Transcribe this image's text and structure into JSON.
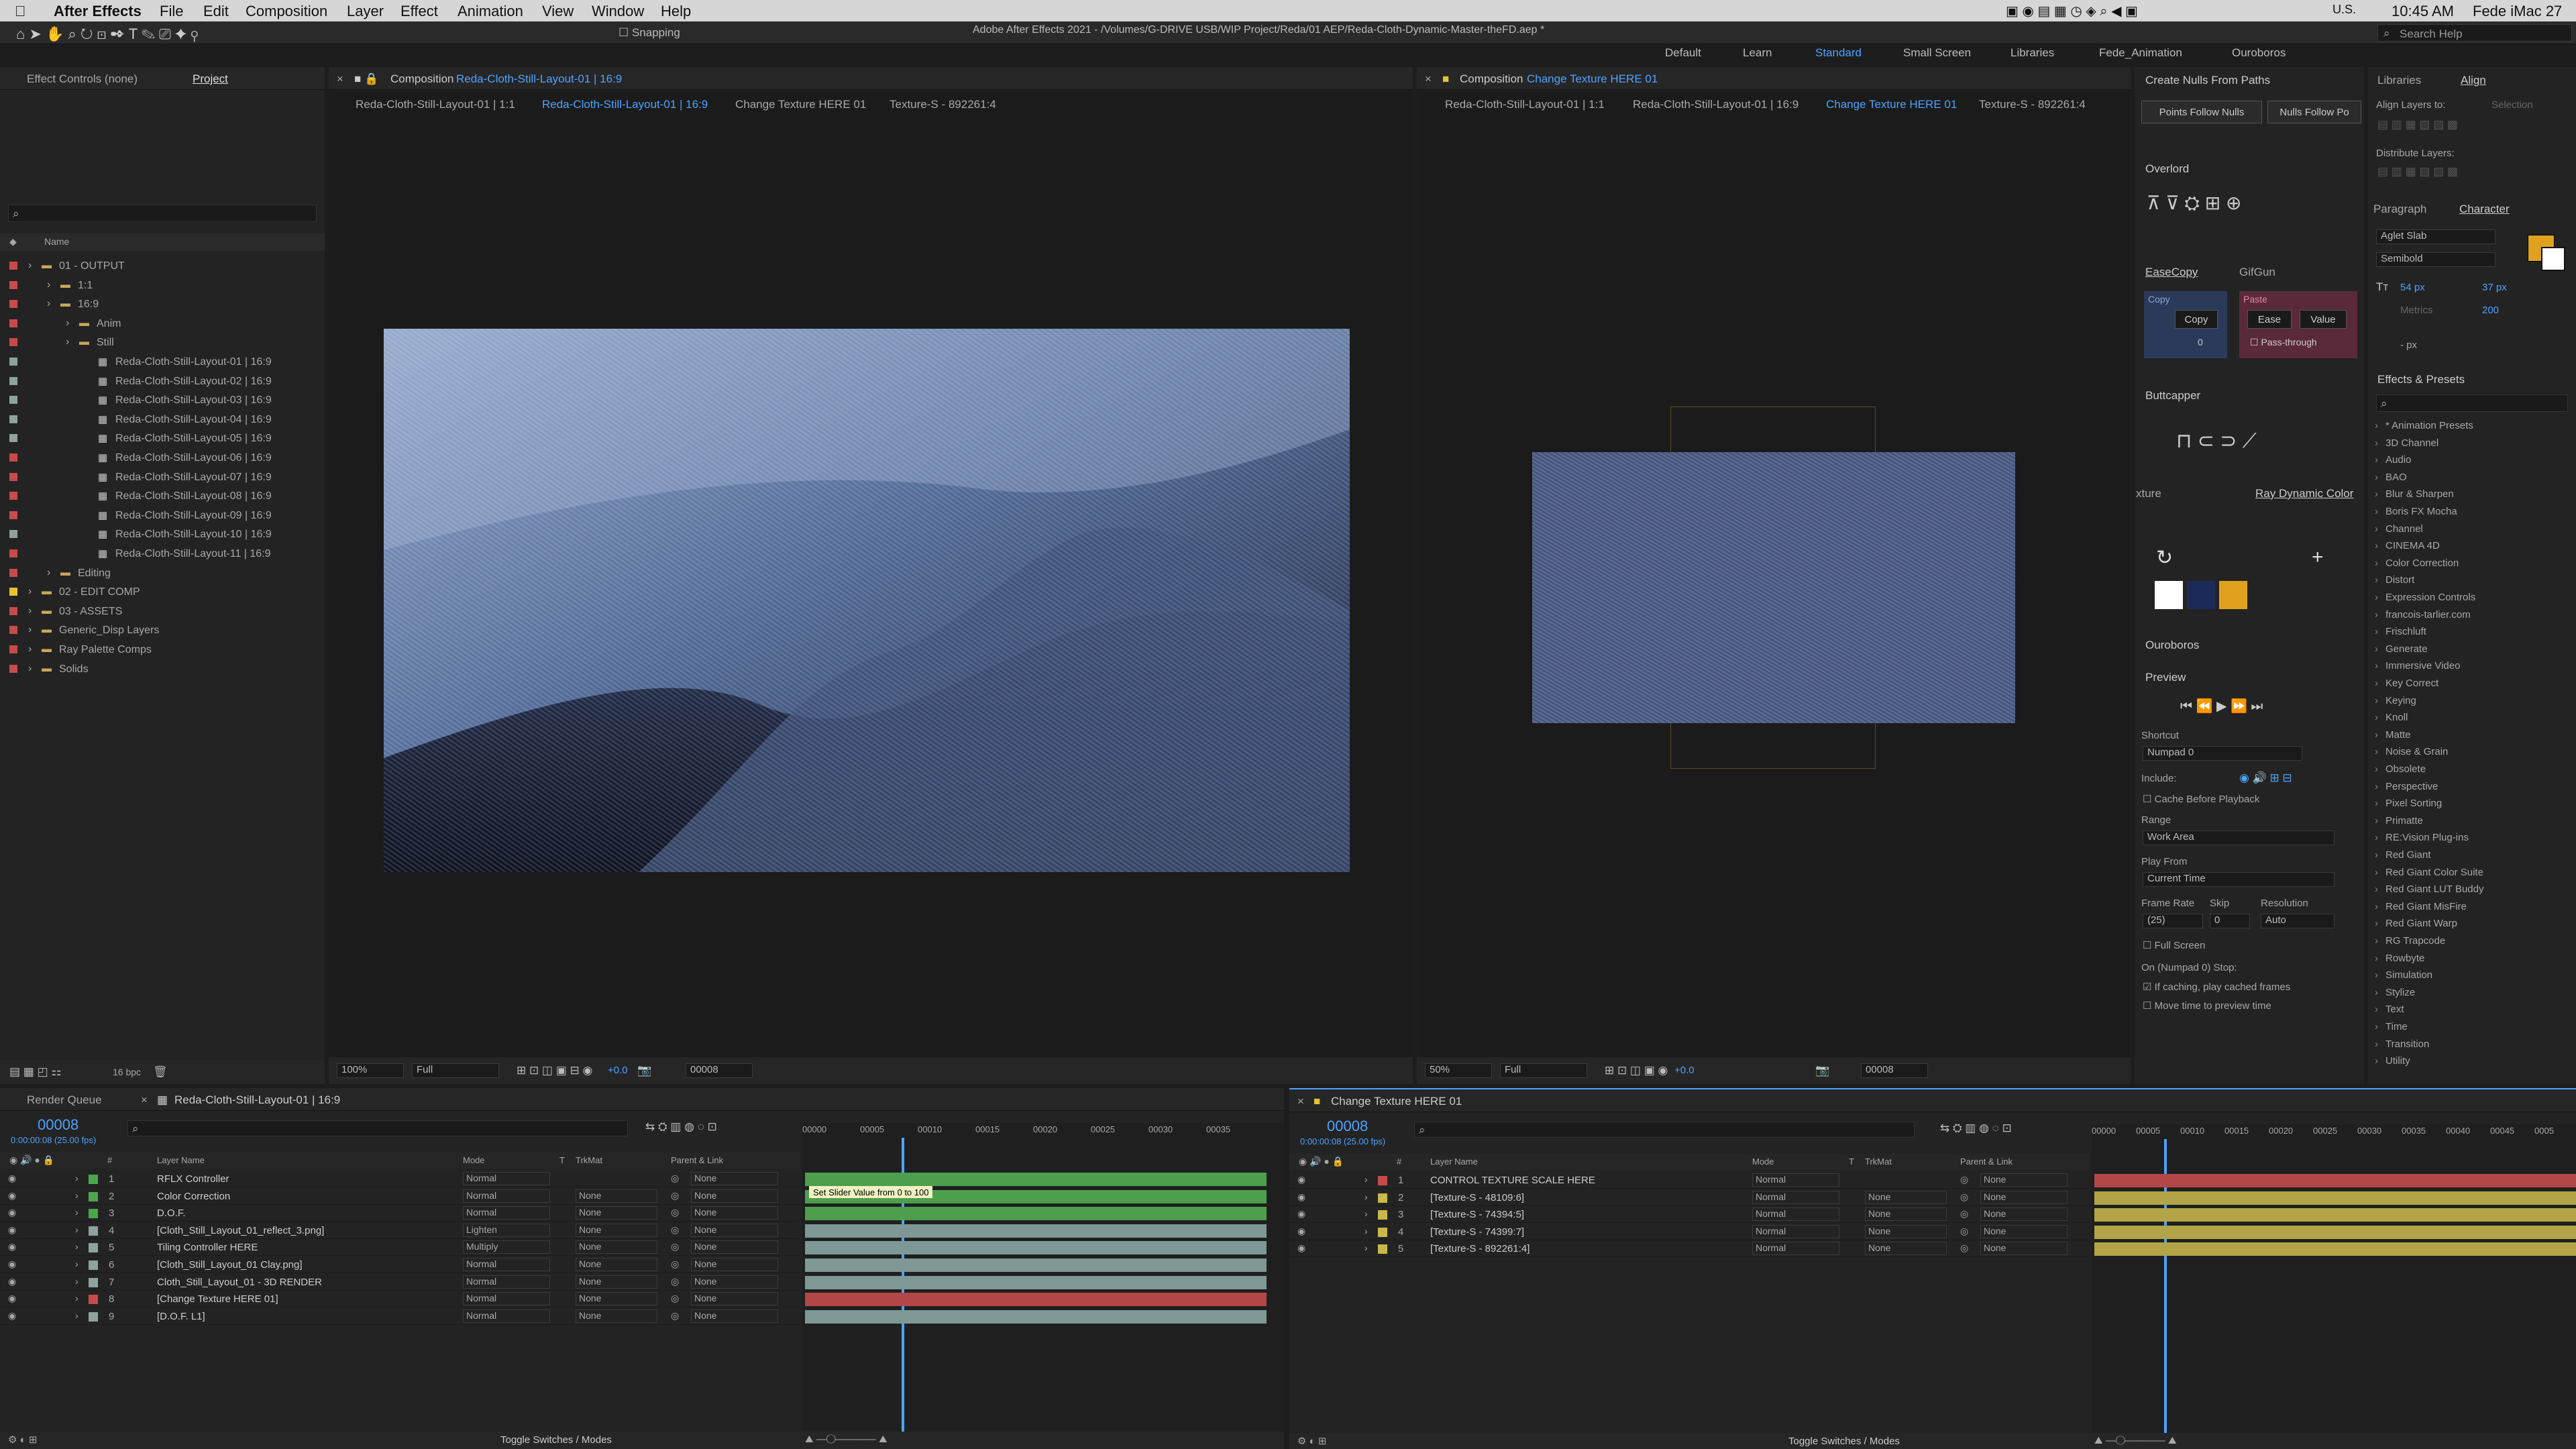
{
  "menubar": {
    "app": "After Effects",
    "items": [
      "File",
      "Edit",
      "Composition",
      "Layer",
      "Effect",
      "Animation",
      "View",
      "Window",
      "Help"
    ],
    "locale": "U.S.",
    "time": "10:45 AM",
    "user": "Fede iMac 27"
  },
  "title": "Adobe After Effects 2021 - /Volumes/G-DRIVE USB/WIP Project/Reda/01 AEP/Reda-Cloth-Dynamic-Master-theFD.aep *",
  "workspaces": [
    "Default",
    "Learn",
    "Standard",
    "Small Screen",
    "Libraries",
    "Fede_Animation",
    "Ouroboros"
  ],
  "search_help": "Search Help",
  "toolbar": {
    "snapping": "Snapping"
  },
  "left": {
    "tab1": "Effect Controls (none)",
    "tab2": "Project",
    "col_name": "Name",
    "bpc": "16 bpc",
    "tree": [
      "01 - OUTPUT",
      "1:1",
      "16:9",
      "Anim",
      "Still",
      "Reda-Cloth-Still-Layout-01 | 16:9",
      "Reda-Cloth-Still-Layout-02 | 16:9",
      "Reda-Cloth-Still-Layout-03 | 16:9",
      "Reda-Cloth-Still-Layout-04 | 16:9",
      "Reda-Cloth-Still-Layout-05 | 16:9",
      "Reda-Cloth-Still-Layout-06 | 16:9",
      "Reda-Cloth-Still-Layout-07 | 16:9",
      "Reda-Cloth-Still-Layout-08 | 16:9",
      "Reda-Cloth-Still-Layout-09 | 16:9",
      "Reda-Cloth-Still-Layout-10 | 16:9",
      "Reda-Cloth-Still-Layout-11 | 16:9",
      "Editing",
      "02 - EDIT COMP",
      "03 - ASSETS",
      "Generic_Disp Layers",
      "Ray Palette Comps",
      "Solids"
    ]
  },
  "comp1": {
    "label": "Composition",
    "name": "Reda-Cloth-Still-Layout-01 | 16:9",
    "crumbs": [
      "Reda-Cloth-Still-Layout-01 | 1:1",
      "Reda-Cloth-Still-Layout-01 | 16:9",
      "Change Texture HERE 01",
      "Texture-S - 892261:4"
    ],
    "zoom": "100%",
    "res": "Full",
    "exposure": "+0.0",
    "frame": "00008"
  },
  "comp2": {
    "label": "Composition",
    "name": "Change Texture HERE 01",
    "crumbs": [
      "Reda-Cloth-Still-Layout-01 | 1:1",
      "Reda-Cloth-Still-Layout-01 | 16:9",
      "Change Texture HERE 01",
      "Texture-S - 892261:4"
    ],
    "zoom": "50%",
    "res": "Full",
    "exposure": "+0.0",
    "frame": "00008"
  },
  "right": {
    "nulls_title": "Create Nulls From Paths",
    "nulls_btns": [
      "Points Follow Nulls",
      "Nulls Follow Po"
    ],
    "overlord": "Overlord",
    "easecopy": "EaseCopy",
    "gifgun": "GifGun",
    "copy": "Copy",
    "paste": "Paste",
    "copy_btn": "Copy",
    "ease_btn": "Ease",
    "value_btn": "Value",
    "pass": "Pass-through",
    "copy_val": "0",
    "buttcapper": "Buttcapper",
    "xture": "xture",
    "rdc": "Ray Dynamic Color",
    "ouroboros": "Ouroboros",
    "preview": "Preview",
    "shortcut": "Shortcut",
    "numpad": "Numpad 0",
    "include": "Include:",
    "cache": "Cache Before Playback",
    "range": "Range",
    "work_area": "Work Area",
    "play_from": "Play From",
    "current_time": "Current Time",
    "frame_rate": "Frame Rate",
    "skip": "Skip",
    "resolution": "Resolution",
    "fr_val": "(25)",
    "skip_val": "0",
    "res_val": "Auto",
    "full_screen": "Full Screen",
    "on_stop": "On (Numpad 0) Stop:",
    "if_caching": "If caching, play cached frames",
    "move_time": "Move time to preview time"
  },
  "far": {
    "libraries": "Libraries",
    "align": "Align",
    "align_to": "Align Layers to:",
    "selection": "Selection",
    "distribute": "Distribute Layers:",
    "paragraph": "Paragraph",
    "character": "Character",
    "font": "Aglet Slab",
    "style": "Semibold",
    "size": "54 px",
    "leading": "37 px",
    "tracking": "200",
    "metrics": "Metrics",
    "px": "- px",
    "effects_title": "Effects & Presets",
    "effects": [
      "* Animation Presets",
      "3D Channel",
      "Audio",
      "BAO",
      "Blur & Sharpen",
      "Boris FX Mocha",
      "Channel",
      "CINEMA 4D",
      "Color Correction",
      "Distort",
      "Expression Controls",
      "francois-tarlier.com",
      "Frischluft",
      "Generate",
      "Immersive Video",
      "Key Correct",
      "Keying",
      "Knoll",
      "Matte",
      "Noise & Grain",
      "Obsolete",
      "Perspective",
      "Pixel Sorting",
      "Primatte",
      "RE:Vision Plug-ins",
      "Red Giant",
      "Red Giant Color Suite",
      "Red Giant LUT Buddy",
      "Red Giant MisFire",
      "Red Giant Warp",
      "RG Trapcode",
      "Rowbyte",
      "Simulation",
      "Stylize",
      "Text",
      "Time",
      "Transition",
      "Utility"
    ]
  },
  "tl1": {
    "tab0": "Render Queue",
    "tab": "Reda-Cloth-Still-Layout-01 | 16:9",
    "time": "00008",
    "fps": "0:00:00:08 (25.00 fps)",
    "cols": [
      "#",
      "Layer Name",
      "Mode",
      "T",
      "TrkMat",
      "Parent & Link"
    ],
    "rulers": [
      "00000",
      "00005",
      "00010",
      "00015",
      "00020",
      "00025",
      "00030",
      "00035"
    ],
    "tooltip": "Set Slider Value from 0 to 100",
    "layers": [
      {
        "n": "1",
        "name": "RFLX Controller",
        "mode": "Normal",
        "trk": "",
        "parent": "None",
        "lab": "#4ba64b",
        "bar": "#4c9f4c"
      },
      {
        "n": "2",
        "name": "Color Correction",
        "mode": "Normal",
        "trk": "None",
        "parent": "None",
        "lab": "#4ba64b",
        "bar": "#4c9f4c"
      },
      {
        "n": "3",
        "name": "D.O.F.",
        "mode": "Normal",
        "trk": "None",
        "parent": "None",
        "lab": "#4ba64b",
        "bar": "#4c9f4c"
      },
      {
        "n": "4",
        "name": "[Cloth_Still_Layout_01_reflect_3.png]",
        "mode": "Lighten",
        "trk": "None",
        "parent": "None",
        "lab": "#8da3a0",
        "bar": "#7d9895"
      },
      {
        "n": "5",
        "name": "Tiling Controller HERE",
        "mode": "Multiply",
        "trk": "None",
        "parent": "None",
        "lab": "#8da3a0",
        "bar": "#7d9895"
      },
      {
        "n": "6",
        "name": "[Cloth_Still_Layout_01 Clay.png]",
        "mode": "Normal",
        "trk": "None",
        "parent": "None",
        "lab": "#8da3a0",
        "bar": "#7d9895"
      },
      {
        "n": "7",
        "name": "Cloth_Still_Layout_01 - 3D RENDER",
        "mode": "Normal",
        "trk": "None",
        "parent": "None",
        "lab": "#8da3a0",
        "bar": "#7d9895"
      },
      {
        "n": "8",
        "name": "[Change Texture HERE 01]",
        "mode": "Normal",
        "trk": "None",
        "parent": "None",
        "lab": "#c94a4a",
        "bar": "#b34747"
      },
      {
        "n": "9",
        "name": "[D.O.F. L1]",
        "mode": "Normal",
        "trk": "None",
        "parent": "None",
        "lab": "#8da3a0",
        "bar": "#7d9895"
      }
    ],
    "toggle": "Toggle Switches / Modes"
  },
  "tl2": {
    "tab": "Change Texture HERE 01",
    "time": "00008",
    "fps": "0:00:00:08 (25.00 fps)",
    "cols": [
      "#",
      "Layer Name",
      "Mode",
      "T",
      "TrkMat",
      "Parent & Link"
    ],
    "rulers": [
      "00000",
      "00005",
      "00010",
      "00015",
      "00020",
      "00025",
      "00030",
      "00035",
      "00040",
      "00045",
      "0005"
    ],
    "layers": [
      {
        "n": "1",
        "name": "CONTROL TEXTURE SCALE HERE",
        "mode": "Normal",
        "trk": "",
        "parent": "None",
        "lab": "#c94a4a",
        "bar": "#b34747"
      },
      {
        "n": "2",
        "name": "[Texture-S - 48109:6]",
        "mode": "Normal",
        "trk": "None",
        "parent": "None",
        "lab": "#c9b84a",
        "bar": "#b3a547"
      },
      {
        "n": "3",
        "name": "[Texture-S - 74394:5]",
        "mode": "Normal",
        "trk": "None",
        "parent": "None",
        "lab": "#c9b84a",
        "bar": "#b3a547"
      },
      {
        "n": "4",
        "name": "[Texture-S - 74399:7]",
        "mode": "Normal",
        "trk": "None",
        "parent": "None",
        "lab": "#c9b84a",
        "bar": "#b3a547"
      },
      {
        "n": "5",
        "name": "[Texture-S - 892261:4]",
        "mode": "Normal",
        "trk": "None",
        "parent": "None",
        "lab": "#c9b84a",
        "bar": "#b3a547"
      }
    ],
    "toggle": "Toggle Switches / Modes"
  }
}
